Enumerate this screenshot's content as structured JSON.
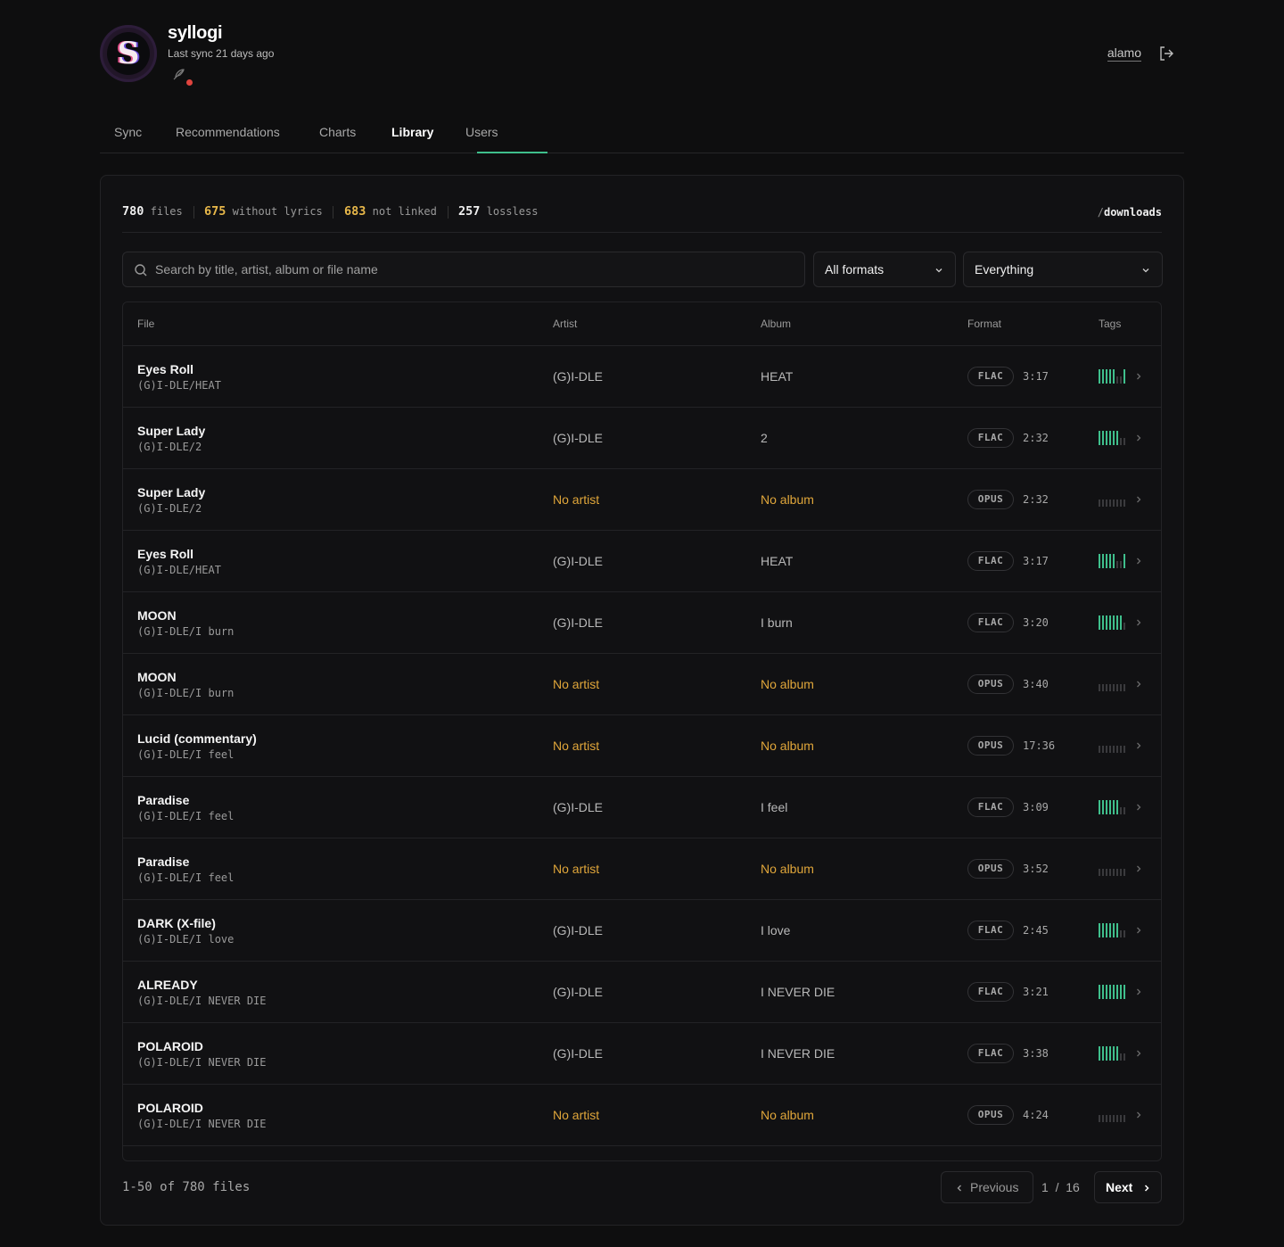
{
  "app": {
    "name": "syllogi",
    "sync_info": "Last sync 21 days ago",
    "logo_letter": "S"
  },
  "user": {
    "name": "alamo"
  },
  "tabs": [
    {
      "label": "Sync"
    },
    {
      "label": "Recommendations"
    },
    {
      "label": "Charts"
    },
    {
      "label": "Library",
      "active": true
    },
    {
      "label": "Users"
    }
  ],
  "stats": {
    "files": {
      "value": "780",
      "label": "files"
    },
    "without_lyrics": {
      "value": "675",
      "label": "without lyrics"
    },
    "not_linked": {
      "value": "683",
      "label": "not linked"
    },
    "lossless": {
      "value": "257",
      "label": "lossless"
    },
    "path_slash": "/",
    "path": "downloads"
  },
  "search": {
    "placeholder": "Search by title, artist, album or file name",
    "value": ""
  },
  "filters": {
    "format": "All formats",
    "scope": "Everything"
  },
  "table": {
    "headers": {
      "file": "File",
      "artist": "Artist",
      "album": "Album",
      "format": "Format",
      "tags": "Tags"
    },
    "rows": [
      {
        "title": "Eyes Roll",
        "path": "(G)I-DLE/HEAT",
        "artist": "(G)I-DLE",
        "album": "HEAT",
        "format": "FLAC",
        "duration": "3:17",
        "tags": [
          1,
          1,
          1,
          1,
          1,
          0,
          0,
          1
        ],
        "missing": false
      },
      {
        "title": "Super Lady",
        "path": "(G)I-DLE/2",
        "artist": "(G)I-DLE",
        "album": "2",
        "format": "FLAC",
        "duration": "2:32",
        "tags": [
          1,
          1,
          1,
          1,
          1,
          1,
          0,
          0
        ],
        "missing": false
      },
      {
        "title": "Super Lady",
        "path": "(G)I-DLE/2",
        "artist": "No artist",
        "album": "No album",
        "format": "OPUS",
        "duration": "2:32",
        "tags": [
          0,
          0,
          0,
          0,
          0,
          0,
          0,
          0
        ],
        "missing": true
      },
      {
        "title": "Eyes Roll",
        "path": "(G)I-DLE/HEAT",
        "artist": "(G)I-DLE",
        "album": "HEAT",
        "format": "FLAC",
        "duration": "3:17",
        "tags": [
          1,
          1,
          1,
          1,
          1,
          0,
          0,
          1
        ],
        "missing": false
      },
      {
        "title": "MOON",
        "path": "(G)I-DLE/I burn",
        "artist": "(G)I-DLE",
        "album": "I burn",
        "format": "FLAC",
        "duration": "3:20",
        "tags": [
          1,
          1,
          1,
          1,
          1,
          1,
          1,
          0
        ],
        "missing": false
      },
      {
        "title": "MOON",
        "path": "(G)I-DLE/I burn",
        "artist": "No artist",
        "album": "No album",
        "format": "OPUS",
        "duration": "3:40",
        "tags": [
          0,
          0,
          0,
          0,
          0,
          0,
          0,
          0
        ],
        "missing": true
      },
      {
        "title": "Lucid (commentary)",
        "path": "(G)I-DLE/I feel",
        "artist": "No artist",
        "album": "No album",
        "format": "OPUS",
        "duration": "17:36",
        "tags": [
          0,
          0,
          0,
          0,
          0,
          0,
          0,
          0
        ],
        "missing": true
      },
      {
        "title": "Paradise",
        "path": "(G)I-DLE/I feel",
        "artist": "(G)I-DLE",
        "album": "I feel",
        "format": "FLAC",
        "duration": "3:09",
        "tags": [
          1,
          1,
          1,
          1,
          1,
          1,
          0,
          0
        ],
        "missing": false
      },
      {
        "title": "Paradise",
        "path": "(G)I-DLE/I feel",
        "artist": "No artist",
        "album": "No album",
        "format": "OPUS",
        "duration": "3:52",
        "tags": [
          0,
          0,
          0,
          0,
          0,
          0,
          0,
          0
        ],
        "missing": true
      },
      {
        "title": "DARK (X-file)",
        "path": "(G)I-DLE/I love",
        "artist": "(G)I-DLE",
        "album": "I love",
        "format": "FLAC",
        "duration": "2:45",
        "tags": [
          1,
          1,
          1,
          1,
          1,
          1,
          0,
          0
        ],
        "missing": false
      },
      {
        "title": "ALREADY",
        "path": "(G)I-DLE/I NEVER DIE",
        "artist": "(G)I-DLE",
        "album": "I NEVER DIE",
        "format": "FLAC",
        "duration": "3:21",
        "tags": [
          1,
          1,
          1,
          1,
          1,
          1,
          1,
          1
        ],
        "missing": false
      },
      {
        "title": "POLAROID",
        "path": "(G)I-DLE/I NEVER DIE",
        "artist": "(G)I-DLE",
        "album": "I NEVER DIE",
        "format": "FLAC",
        "duration": "3:38",
        "tags": [
          1,
          1,
          1,
          1,
          1,
          1,
          0,
          0
        ],
        "missing": false
      },
      {
        "title": "POLAROID",
        "path": "(G)I-DLE/I NEVER DIE",
        "artist": "No artist",
        "album": "No album",
        "format": "OPUS",
        "duration": "4:24",
        "tags": [
          0,
          0,
          0,
          0,
          0,
          0,
          0,
          0
        ],
        "missing": true
      }
    ]
  },
  "pagination": {
    "range": "1-50 of 780 files",
    "previous": "Previous",
    "next": "Next",
    "current": "1",
    "separator": "/",
    "total": "16"
  },
  "colors": {
    "accent": "#3fbf8c",
    "warning": "#e0a63a",
    "tag_on": "#3fbf8c",
    "tag_off": "#3a3a3d"
  }
}
